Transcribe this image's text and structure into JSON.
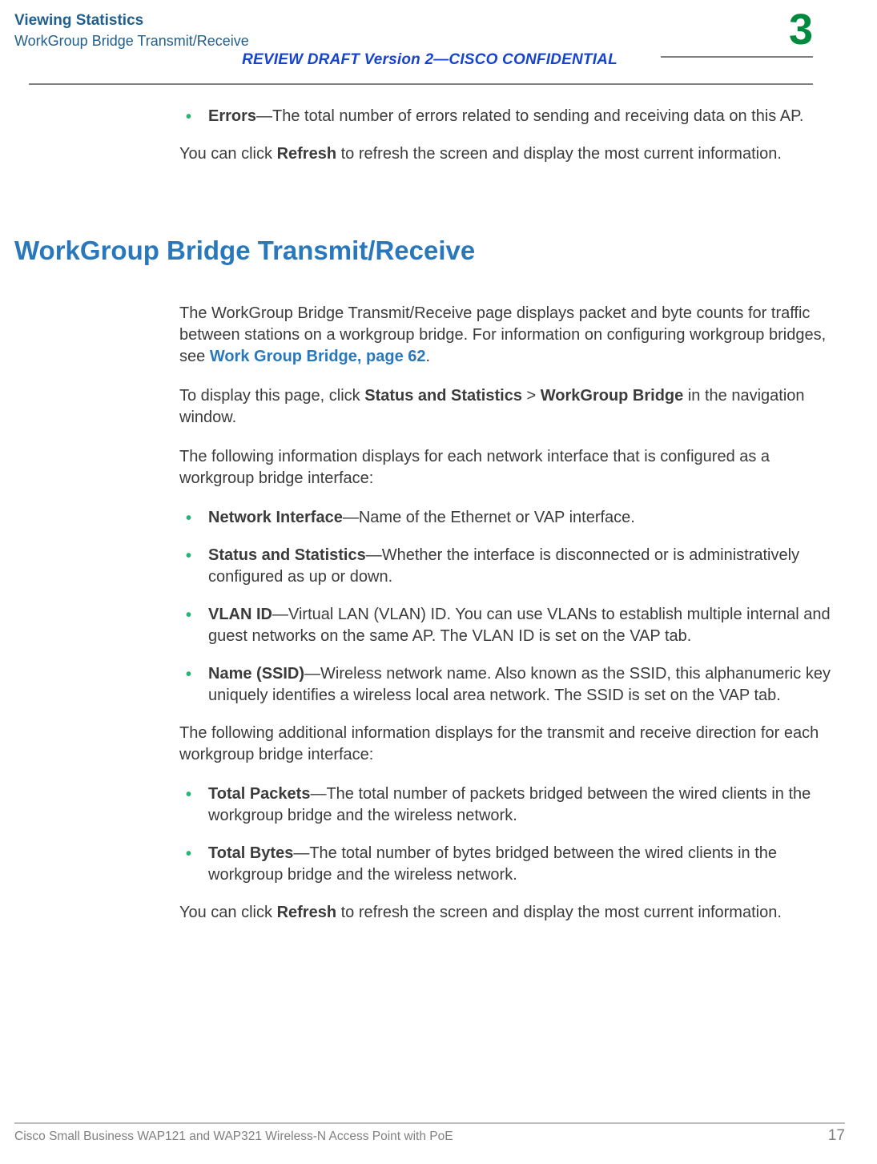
{
  "header": {
    "title": "Viewing Statistics",
    "subtitle": "WorkGroup Bridge Transmit/Receive",
    "review_draft": "REVIEW DRAFT  Version 2—CISCO CONFIDENTIAL",
    "chapter_num": "3"
  },
  "section1": {
    "bullets": [
      {
        "term": "Errors",
        "text": "—The total number of errors related to sending and receiving data on this AP."
      }
    ],
    "para": {
      "pre": "You can click ",
      "bold": "Refresh",
      "post": " to refresh the screen and display the most current information."
    }
  },
  "h2": "WorkGroup Bridge Transmit/Receive",
  "section2": {
    "intro_a": "The WorkGroup Bridge Transmit/Receive page displays packet and byte counts for traffic between stations on a workgroup bridge. For information on configuring workgroup bridges, see ",
    "intro_link": "Work Group Bridge, page 62",
    "intro_b": ".",
    "nav_pre": "To display this page, click ",
    "nav_b1": "Status and Statistics",
    "nav_mid": " > ",
    "nav_b2": "WorkGroup Bridge",
    "nav_post": " in the navigation window.",
    "lead1": "The following information displays for each network interface that is configured as a workgroup bridge interface:",
    "bullets1": [
      {
        "term": "Network Interface",
        "text": "—Name of the Ethernet or VAP interface."
      },
      {
        "term": "Status and Statistics",
        "text": "—Whether the interface is disconnected or is administratively configured as up or down."
      },
      {
        "term": "VLAN ID",
        "text": "—Virtual LAN (VLAN) ID. You can use VLANs to establish multiple internal and guest networks on the same AP. The VLAN ID is set on the VAP tab."
      },
      {
        "term": "Name (SSID)",
        "text": "—Wireless network name. Also known as the SSID, this alphanumeric key uniquely identifies a wireless local area network. The SSID is set on the VAP tab."
      }
    ],
    "lead2": "The following additional information displays for the transmit and receive direction for each workgroup bridge interface:",
    "bullets2": [
      {
        "term": "Total Packets",
        "text": "—The total number of packets bridged between the wired clients in the workgroup bridge and the wireless network."
      },
      {
        "term": "Total Bytes",
        "text": "—The total number of bytes bridged between the wired clients in the workgroup bridge and the wireless network."
      }
    ],
    "para_end": {
      "pre": "You can click ",
      "bold": "Refresh",
      "post": " to refresh the screen and display the most current information."
    }
  },
  "footer": {
    "text": "Cisco Small Business WAP121 and WAP321 Wireless-N Access Point with PoE",
    "page": "17"
  }
}
